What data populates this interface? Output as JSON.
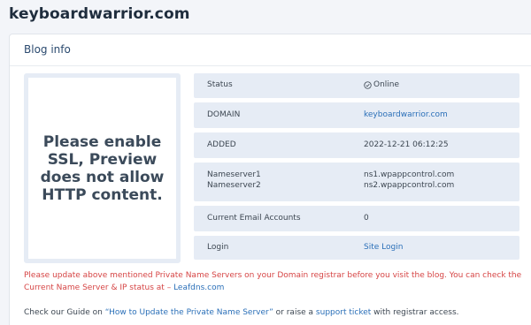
{
  "site": {
    "title": "keyboardwarrior.com"
  },
  "card": {
    "title": "Blog info"
  },
  "preview": {
    "message": "Please enable SSL, Preview does not allow HTTP content."
  },
  "info": {
    "status_label": "Status",
    "status_value": "Online",
    "status_icon": "check-circle-icon",
    "domain_label": "DOMAIN",
    "domain_value": "keyboardwarrior.com",
    "added_label": "ADDED",
    "added_value": "2022-12-21 06:12:25",
    "ns1_label": "Nameserver1",
    "ns1_value": "ns1.wpappcontrol.com",
    "ns2_label": "Nameserver2",
    "ns2_value": "ns2.wpappcontrol.com",
    "email_label": "Current Email Accounts",
    "email_value": "0",
    "login_label": "Login",
    "login_value": "Site Login"
  },
  "notice": {
    "text": "Please update above mentioned Private Name Servers on your Domain registrar before you visit the blog. You can check the Current Name Server & IP status at –",
    "link": "Leafdns.com"
  },
  "guide": {
    "prefix": "Check our Guide on",
    "link": "“How to Update the Private Name Server”",
    "middle": "or raise a",
    "ticket_link": "support ticket",
    "suffix": "with registrar access."
  },
  "colors": {
    "accent": "#2a6fb8",
    "warning": "#d64545",
    "row_bg": "#e6ecf5"
  }
}
